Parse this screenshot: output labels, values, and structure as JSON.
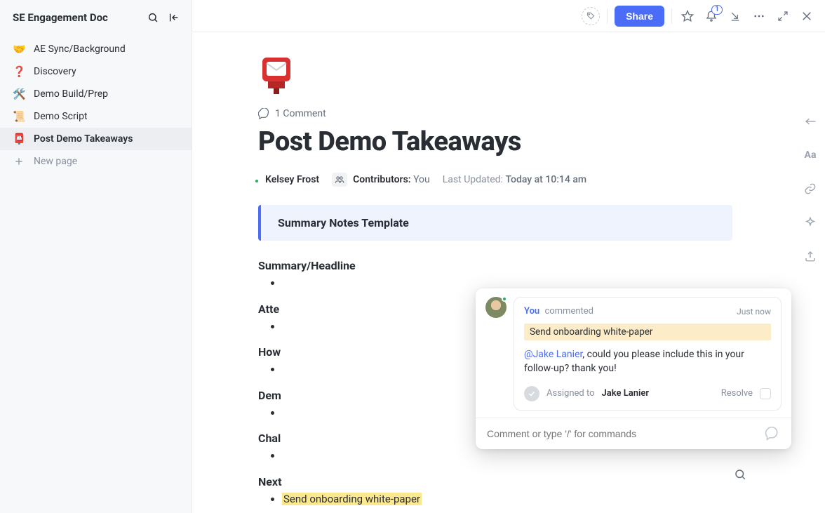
{
  "sidebar": {
    "title": "SE Engagement Doc",
    "items": [
      {
        "emoji": "🤝",
        "label": "AE Sync/Background",
        "active": false
      },
      {
        "emoji": "❓",
        "label": "Discovery",
        "active": false
      },
      {
        "emoji": "🛠️",
        "label": "Demo Build/Prep",
        "active": false
      },
      {
        "emoji": "📜",
        "label": "Demo Script",
        "active": false
      },
      {
        "emoji": "📮",
        "label": "Post Demo Takeaways",
        "active": true
      }
    ],
    "new_page_label": "New page"
  },
  "topbar": {
    "share_label": "Share",
    "notification_count": "1"
  },
  "doc": {
    "comment_count_label": "1 Comment",
    "title": "Post Demo Takeaways",
    "author_name": "Kelsey Frost",
    "contributors_label": "Contributors:",
    "contributors_value": "You",
    "updated_label": "Last Updated:",
    "updated_value": "Today at 10:14 am",
    "callout": "Summary Notes Template",
    "sections": [
      "Summary/Headline",
      "Atte",
      "How",
      "Dem",
      "Chal",
      "Next"
    ],
    "highlighted_item": "Send onboarding white-paper"
  },
  "comment": {
    "author": "You",
    "verb": "commented",
    "time": "Just now",
    "quote": "Send onboarding white-paper",
    "mention": "@Jake Lanier",
    "body_rest": ", could you please include this in your follow-up? thank you!",
    "assigned_label": "Assigned to",
    "assignee": "Jake Lanier",
    "resolve_label": "Resolve",
    "input_placeholder": "Comment or type '/' for commands"
  },
  "right_rail": {
    "aa_label": "Aa"
  }
}
